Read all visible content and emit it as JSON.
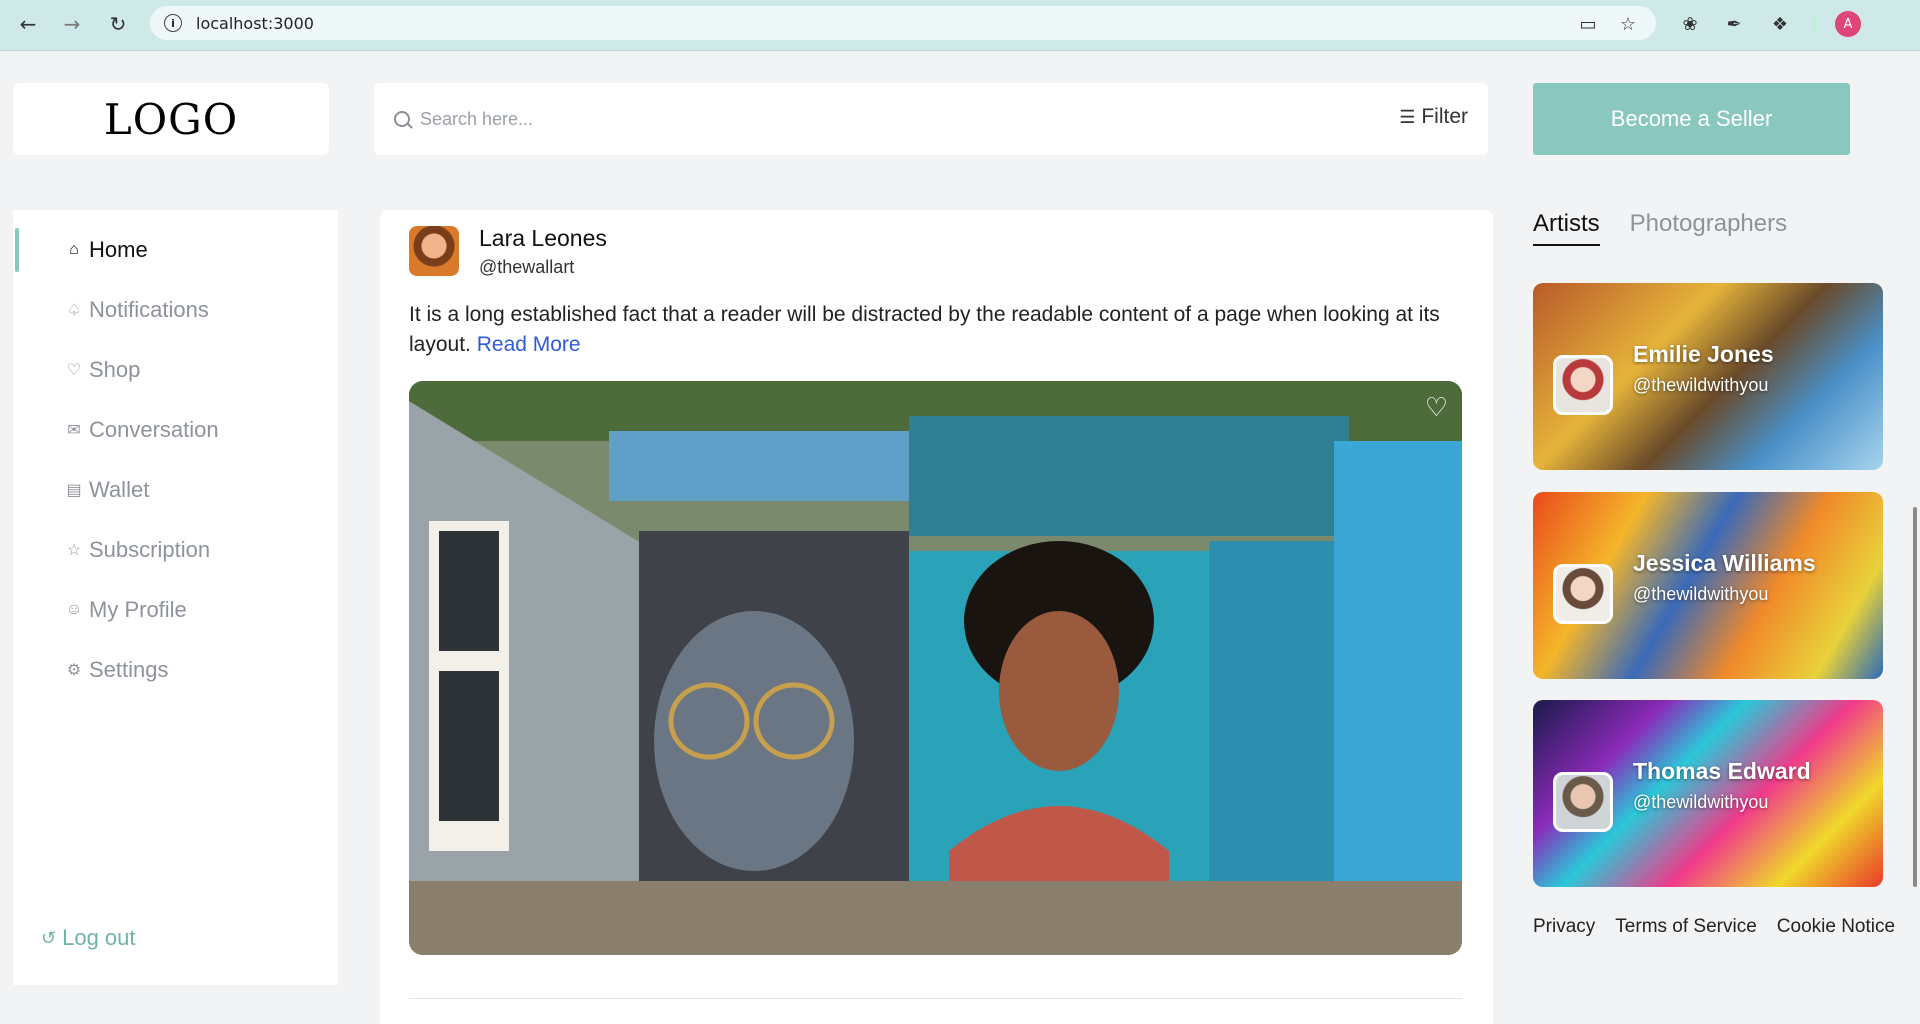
{
  "browser": {
    "url": "localhost:3000",
    "profile_initial": "A"
  },
  "header": {
    "logo_text": "LOGO",
    "search_placeholder": "Search here...",
    "filter_label": "Filter",
    "seller_button_label": "Become a Seller"
  },
  "sidebar": {
    "items": [
      {
        "label": "Home",
        "icon": "home-icon",
        "active": true
      },
      {
        "label": "Notifications",
        "icon": "bell-icon",
        "active": false
      },
      {
        "label": "Shop",
        "icon": "heart-icon",
        "active": false
      },
      {
        "label": "Conversation",
        "icon": "mail-icon",
        "active": false
      },
      {
        "label": "Wallet",
        "icon": "wallet-icon",
        "active": false
      },
      {
        "label": "Subscription",
        "icon": "star-icon",
        "active": false
      },
      {
        "label": "My Profile",
        "icon": "user-icon",
        "active": false
      },
      {
        "label": "Settings",
        "icon": "gear-icon",
        "active": false
      }
    ],
    "logout_label": "Log out"
  },
  "post": {
    "author_name": "Lara Leones",
    "author_handle": "@thewallart",
    "text": "It is a long established fact that a reader will be distracted by the readable content of a page when looking at its layout.",
    "read_more_label": "Read More"
  },
  "right": {
    "tabs": [
      {
        "label": "Artists",
        "active": true
      },
      {
        "label": "Photographers",
        "active": false
      }
    ],
    "cards": [
      {
        "name": "Emilie Jones",
        "handle": "@thewildwithyou"
      },
      {
        "name": "Jessica Williams",
        "handle": "@thewildwithyou"
      },
      {
        "name": "Thomas Edward",
        "handle": "@thewildwithyou"
      }
    ],
    "footer_links": [
      "Privacy",
      "Terms of Service",
      "Cookie Notice"
    ]
  },
  "colors": {
    "accent": "#8ac7bf",
    "link": "#2f5bd6",
    "chrome": "#cfe8e8"
  }
}
